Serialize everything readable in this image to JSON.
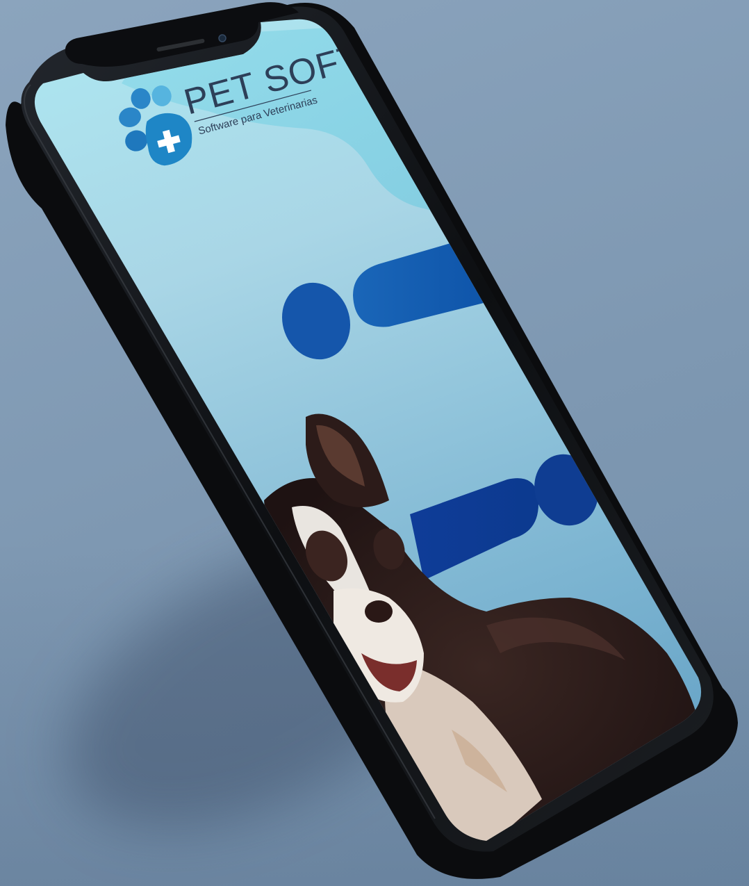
{
  "app": {
    "logo_title": "PET SOFT",
    "logo_subtitle": "Software para Veterinarias"
  },
  "colors": {
    "background": "#7f9ab5",
    "screen_top": "#9ee3ef",
    "screen_bottom": "#6fa9c9",
    "accent_dark": "#0d3f97",
    "accent_mid": "#1a5fb0",
    "paw_blue": "#2a86c8",
    "phone_body": "#111316"
  },
  "icons": {
    "logo": "paw-plus-icon",
    "camera": "front-camera-icon"
  }
}
